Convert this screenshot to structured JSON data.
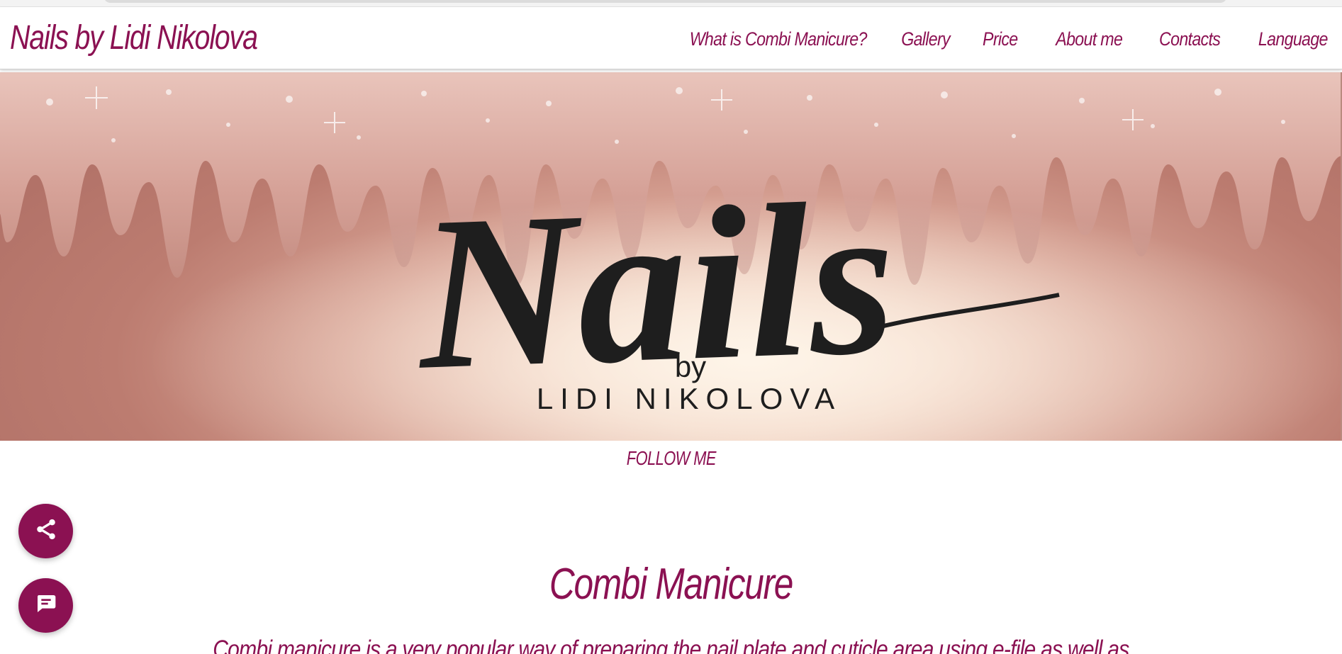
{
  "header": {
    "brand": "Nails by Lidi Nikolova",
    "nav": [
      {
        "label": "What is Combi Manicure?"
      },
      {
        "label": "Gallery"
      },
      {
        "label": "Price"
      },
      {
        "label": "About me"
      },
      {
        "label": "Contacts"
      },
      {
        "label": "Language"
      }
    ]
  },
  "hero": {
    "logo_script": "Nails",
    "logo_by": "by",
    "logo_name": "LIDI NIKOLOVA"
  },
  "follow": {
    "label": "FOLLOW ME"
  },
  "fabs": [
    {
      "icon": "share-icon"
    },
    {
      "icon": "chat-icon"
    }
  ],
  "content": {
    "title": "Combi Manicure",
    "intro": "Combi manicure is a very popular way of preparing the nail plate and cuticle area using e-file as well as"
  },
  "colors": {
    "accent": "#8b1152",
    "hero_glitter": "#d8a9a0",
    "hero_light": "#f9ebde"
  }
}
